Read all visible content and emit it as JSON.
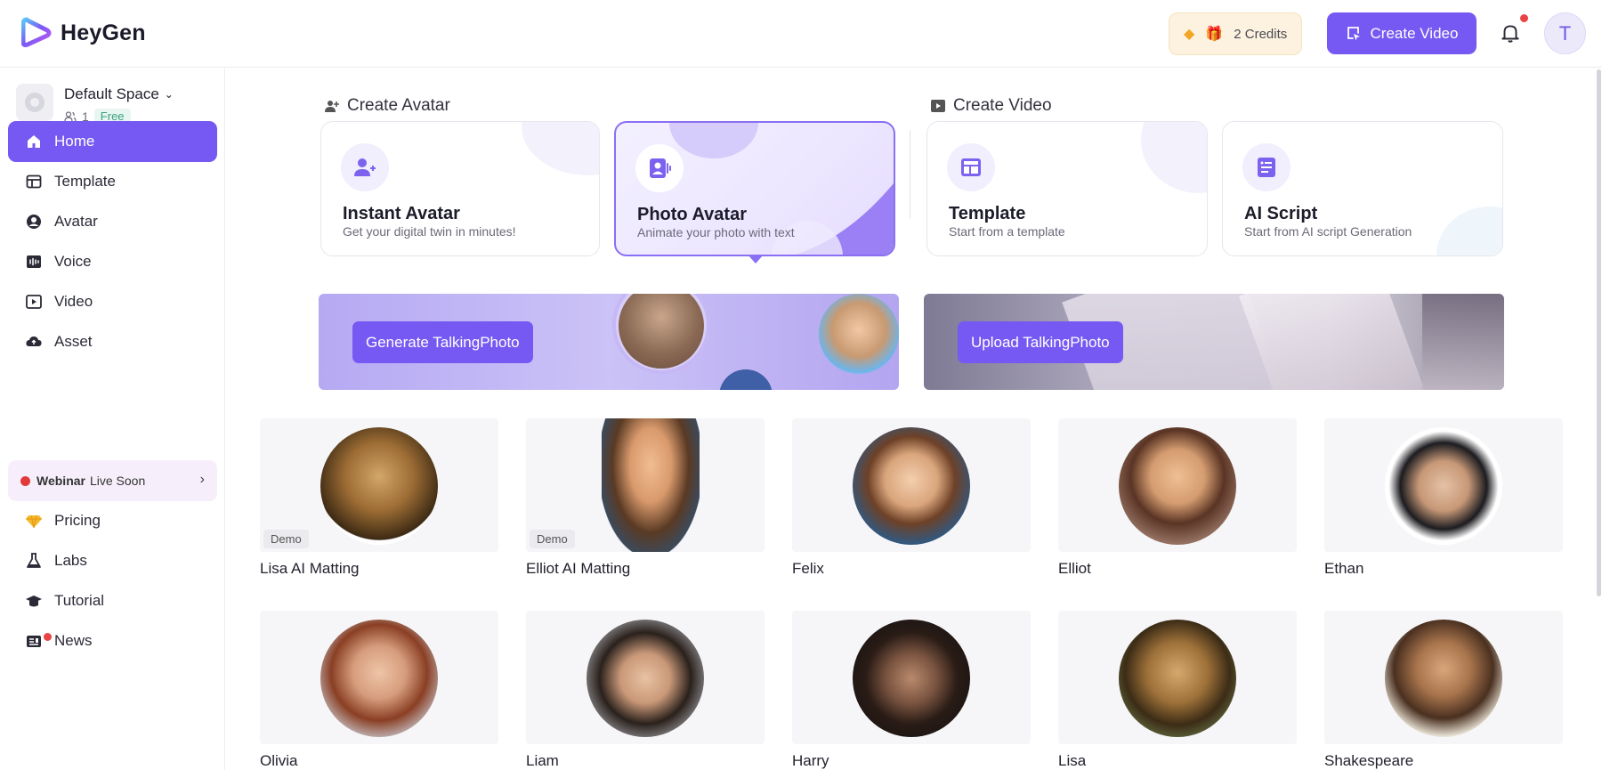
{
  "app": {
    "name": "HeyGen"
  },
  "header": {
    "credits_label": "2 Credits",
    "create_video_label": "Create Video",
    "user_initial": "T"
  },
  "sidebar": {
    "space_name": "Default Space",
    "member_count": "1",
    "plan_badge": "Free",
    "items": [
      {
        "label": "Home",
        "icon": "home-icon",
        "active": true
      },
      {
        "label": "Template",
        "icon": "template-icon"
      },
      {
        "label": "Avatar",
        "icon": "avatar-icon"
      },
      {
        "label": "Voice",
        "icon": "voice-icon"
      },
      {
        "label": "Video",
        "icon": "video-icon"
      },
      {
        "label": "Asset",
        "icon": "cloud-upload-icon"
      }
    ],
    "webinar": {
      "bold": "Webinar",
      "text": "Live Soon"
    },
    "bottom_items": [
      {
        "label": "Pricing",
        "icon": "diamond-icon"
      },
      {
        "label": "Labs",
        "icon": "flask-icon"
      },
      {
        "label": "Tutorial",
        "icon": "graduation-cap-icon"
      },
      {
        "label": "News",
        "icon": "news-icon"
      }
    ]
  },
  "main": {
    "create_avatar_label": "Create Avatar",
    "create_video_label": "Create Video",
    "cards": [
      {
        "title": "Instant Avatar",
        "subtitle": "Get your digital twin in minutes!"
      },
      {
        "title": "Photo Avatar",
        "subtitle": "Animate your photo with text"
      },
      {
        "title": "Template",
        "subtitle": "Start from a template"
      },
      {
        "title": "AI Script",
        "subtitle": "Start from AI script Generation"
      }
    ],
    "banners": [
      {
        "button": "Generate TalkingPhoto"
      },
      {
        "button": "Upload TalkingPhoto"
      }
    ],
    "demo_tag": "Demo",
    "avatars": [
      {
        "name": "Lisa AI Matting",
        "demo": true
      },
      {
        "name": "Elliot AI Matting",
        "demo": true
      },
      {
        "name": "Felix"
      },
      {
        "name": "Elliot"
      },
      {
        "name": "Ethan"
      },
      {
        "name": "Olivia"
      },
      {
        "name": "Liam"
      },
      {
        "name": "Harry"
      },
      {
        "name": "Lisa"
      },
      {
        "name": "Shakespeare"
      }
    ]
  },
  "colors": {
    "accent": "#7559f2",
    "selected_border": "#8a6ff2",
    "notification": "#e94343"
  }
}
